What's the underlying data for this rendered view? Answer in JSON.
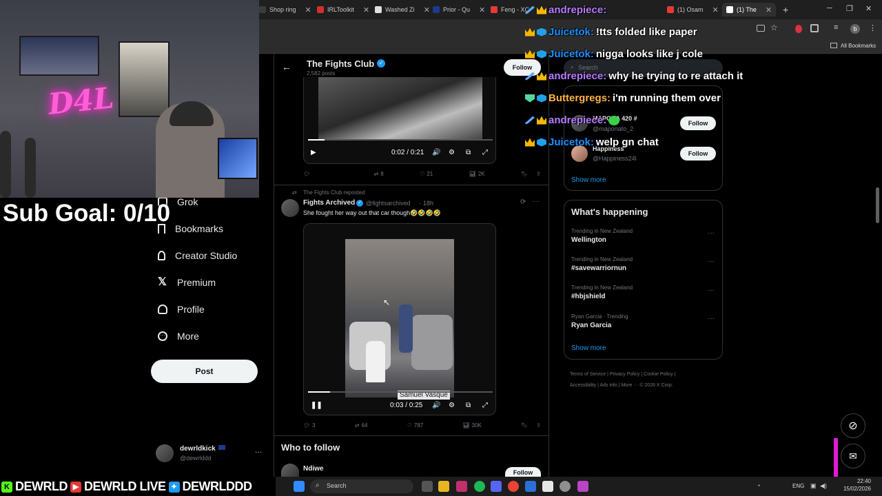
{
  "browser": {
    "tabs": [
      {
        "label": "Shop ring"
      },
      {
        "label": "IRLToolkit"
      },
      {
        "label": "Washed Zi"
      },
      {
        "label": "Prior - Qu"
      },
      {
        "label": "Feng - XC"
      },
      {
        "label": "(1) Osam"
      },
      {
        "label": "(1) The"
      }
    ],
    "bookmarks_label": "All Bookmarks",
    "profile_initial": "b"
  },
  "sidebar": {
    "items": [
      {
        "label": "Grok",
        "icon": "grok-icon"
      },
      {
        "label": "Bookmarks",
        "icon": "bookmark-icon"
      },
      {
        "label": "Creator Studio",
        "icon": "creator-studio-icon"
      },
      {
        "label": "Premium",
        "icon": "x-logo-icon"
      },
      {
        "label": "Profile",
        "icon": "person-icon"
      },
      {
        "label": "More",
        "icon": "more-circle-icon"
      }
    ],
    "post_label": "Post",
    "user": {
      "name": "dewrldkick",
      "handle": "@dewrlddd"
    }
  },
  "header": {
    "title": "The Fights Club",
    "posts": "2,582 posts",
    "follow_label": "Follow"
  },
  "post1": {
    "time": "0:02 / 0:21",
    "progress": 0.09,
    "retweets": "8",
    "likes": "21",
    "views": "2K"
  },
  "post2": {
    "repost_label": "The Fights Club reposted",
    "author": "Fights Archived",
    "handle": "@fightsarchived",
    "age": "18h",
    "text": "She fought her way out that car though🤣🤣🤣🤣",
    "caption": "Samuel Vasque",
    "time": "0:03 / 0:25",
    "progress": 0.12,
    "replies": "3",
    "retweets": "64",
    "likes": "787",
    "views": "30K"
  },
  "who_to_follow": {
    "title": "Who to follow",
    "first_name": "Ndiwe",
    "follow_label": "Follow"
  },
  "right": {
    "search_placeholder": "Search",
    "suggest": [
      {
        "name": "MAPONA 420 #",
        "handle": "@maponato_2",
        "follow_label": "Follow"
      },
      {
        "name": "Happiness",
        "handle": "@Happiness24l",
        "follow_label": "Follow"
      }
    ],
    "show_more": "Show more",
    "whats_happening": "What's happening",
    "trends": [
      {
        "context": "Trending in New Zealand",
        "name": "Wellington"
      },
      {
        "context": "Trending in New Zealand",
        "name": "#savewarriornun"
      },
      {
        "context": "Trending in New Zealand",
        "name": "#hbjshield"
      },
      {
        "context": "Ryan Garcia · Trending",
        "name": "Ryan Garcia"
      }
    ],
    "footer": [
      "Terms of Service",
      "Privacy Policy",
      "Cookie Policy",
      "Accessibility",
      "Ads info",
      "More ···",
      "© 2026 X Corp."
    ]
  },
  "stream": {
    "sub_goal": "Sub Goal: 0/10",
    "neon_sign": "D4L",
    "chat": [
      {
        "user": "andrepiece:",
        "msg": "",
        "color": "#b77cff"
      },
      {
        "user": "Juicetok:",
        "msg": "!tts folded like paper",
        "color": "#1e90ff"
      },
      {
        "user": "Juicetok:",
        "msg": "nigga looks like j cole",
        "color": "#1e90ff"
      },
      {
        "user": "andrepiece:",
        "msg": "why he trying to re attach it",
        "color": "#b77cff"
      },
      {
        "user": "Buttergregs:",
        "msg": "i'm running them over",
        "color": "#ffb347"
      },
      {
        "user": "andrepiece:",
        "msg": "",
        "color": "#b77cff"
      },
      {
        "user": "Juicetok:",
        "msg": "welp gn chat",
        "color": "#1e90ff"
      }
    ],
    "socials": [
      "DEWRLD",
      "DEWRLD LIVE",
      "DEWRLDDD"
    ]
  },
  "taskbar": {
    "search_placeholder": "Search",
    "lang": "ENG",
    "time": "22:40",
    "date": "15/02/2026"
  }
}
